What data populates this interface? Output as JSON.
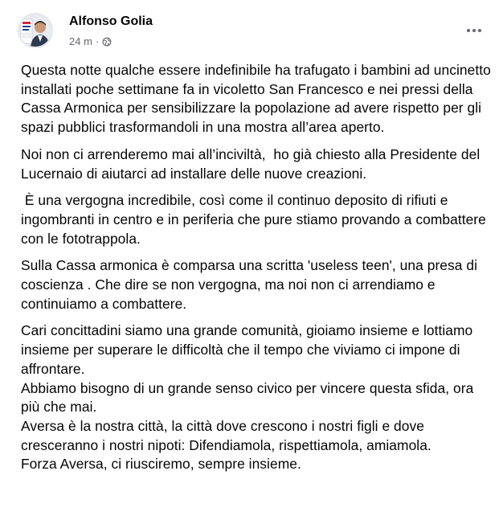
{
  "post": {
    "author": "Alfonso Golia",
    "time": "24 m",
    "separator": "·",
    "privacy_icon": "globe-icon",
    "more_icon": "more-horizontal-icon",
    "paragraphs": [
      "Questa notte qualche essere indefinibile ha trafugato i bambini ad uncinetto installati poche settimane fa in vicoletto San Francesco e nei pressi della Cassa Armonica per sensibilizzare la popolazione ad avere rispetto per gli spazi pubblici trasformandoli in una mostra all’area aperto.",
      "Noi non ci arrenderemo mai all’inciviltà,  ho già chiesto alla Presidente del Lucernaio di aiutarci ad installare delle nuove creazioni.",
      " È una vergogna incredibile, così come il continuo deposito di rifiuti e ingombranti in centro e in periferia che pure stiamo provando a combattere con le fototrappola.",
      "Sulla Cassa armonica è comparsa una scritta 'useless teen', una presa di coscienza . Che dire se non vergogna, ma noi non ci arrendiamo e continuiamo a combattere.",
      "Cari concittadini siamo una grande comunità, gioiamo insieme e lottiamo insieme per superare le difficoltà che il tempo che viviamo ci impone di affrontare.",
      "Abbiamo bisogno di un grande senso civico per vincere questa sfida, ora più che mai.",
      "Aversa è la nostra città, la città dove crescono i nostri figli e dove cresceranno i nostri nipoti: Difendiamola, rispettiamola, amiamola.",
      "Forza Aversa, ci riusciremo, sempre insieme."
    ]
  }
}
